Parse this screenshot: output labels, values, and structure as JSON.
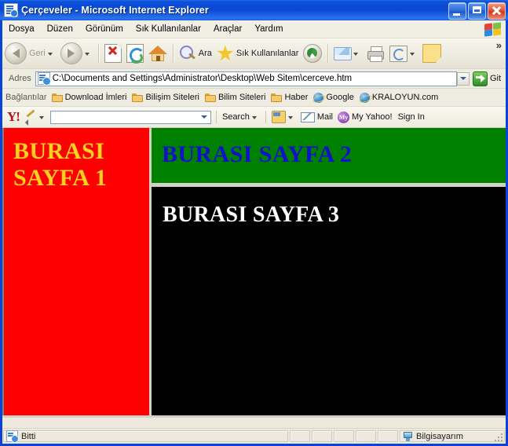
{
  "window": {
    "title": "Çerçeveler - Microsoft Internet Explorer",
    "icon": "ie-document-icon",
    "buttons": {
      "minimize": "minimize",
      "maximize": "maximize",
      "close": "close"
    }
  },
  "menubar": {
    "items": [
      {
        "label": "Dosya"
      },
      {
        "label": "Düzen"
      },
      {
        "label": "Görünüm"
      },
      {
        "label": "Sık Kullanılanlar"
      },
      {
        "label": "Araçlar"
      },
      {
        "label": "Yardım"
      }
    ],
    "brand_icon": "windows-flag-icon"
  },
  "toolbar": {
    "back_label": "Geri",
    "forward_label": "",
    "search_label": "Ara",
    "favorites_label": "Sık Kullanılanlar",
    "overflow": "»",
    "icons": [
      "back-icon",
      "forward-icon",
      "stop-icon",
      "refresh-icon",
      "home-icon",
      "search-icon",
      "favorites-star-icon",
      "media-icon",
      "mail-icon",
      "print-icon",
      "edit-icon",
      "notes-icon"
    ]
  },
  "address": {
    "label": "Adres",
    "value": "C:\\Documents and Settings\\Administrator\\Desktop\\Web Sitem\\cerceve.htm",
    "placeholder": "",
    "go_label": "Git"
  },
  "links": {
    "label": "Bağlantılar",
    "items": [
      {
        "label": "Download İmleri",
        "icon": "folder-icon"
      },
      {
        "label": "Bilişim Siteleri",
        "icon": "folder-icon"
      },
      {
        "label": "Bilim Siteleri",
        "icon": "folder-icon"
      },
      {
        "label": "Haber",
        "icon": "folder-icon"
      },
      {
        "label": "Google",
        "icon": "ie-page-icon"
      },
      {
        "label": "KRALOYUN.com",
        "icon": "ie-page-icon"
      }
    ]
  },
  "yahoo_toolbar": {
    "logo": "Y!",
    "search_value": "",
    "search_placeholder": "",
    "search_label": "Search",
    "mail_label": "Mail",
    "my_yahoo_label": "My Yahoo!",
    "my_yahoo_badge": "My",
    "sign_in_label": "Sign In"
  },
  "frames": {
    "frame1": {
      "text": "BURASI\nSAYFA 1",
      "line1": "BURASI",
      "line2": "SAYFA 1",
      "bg": "#ff0000",
      "fg": "#ffd21e"
    },
    "frame2": {
      "text": "BURASI SAYFA 2",
      "bg": "#008000",
      "fg": "#1111cc"
    },
    "frame3": {
      "text": "BURASI SAYFA 3",
      "bg": "#000000",
      "fg": "#ffffff"
    }
  },
  "statusbar": {
    "status_text": "Bitti",
    "zone_text": "Bilgisayarım",
    "status_icon": "ie-page-icon",
    "zone_icon": "computer-icon"
  }
}
